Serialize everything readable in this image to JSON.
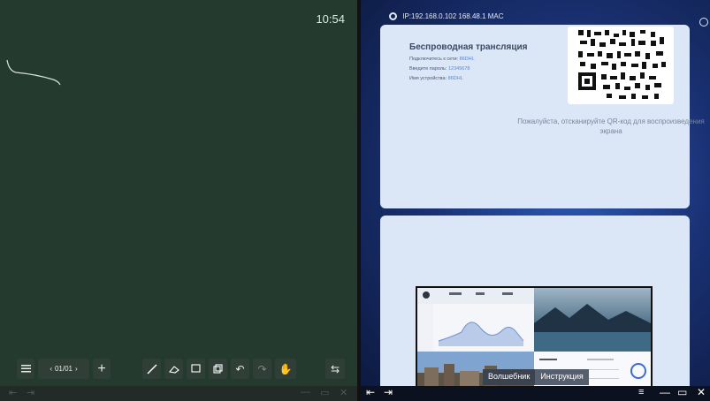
{
  "left_panel": {
    "clock": "10:54",
    "pager": "01/01"
  },
  "right_panel": {
    "topbar": "IP:192.168.0.102 168.48.1 MAC",
    "wireless": {
      "title": "Беспроводная трансляция",
      "rows": [
        {
          "label": "Подключитесь к сети:",
          "value": "86DHL"
        },
        {
          "label": "Введите пароль:",
          "value": "12345678"
        },
        {
          "label": "Имя устройства:",
          "value": "86DHL"
        }
      ],
      "scan_text": "Пожалуйста, отсканируйте QR-код для воспроизведения экрана"
    },
    "tabs": [
      "Волшебник",
      "Инструкция"
    ]
  },
  "colors": {
    "left_bg": "#243a2f",
    "card_bg": "#dbe6f6",
    "accent": "#5a86d6"
  }
}
